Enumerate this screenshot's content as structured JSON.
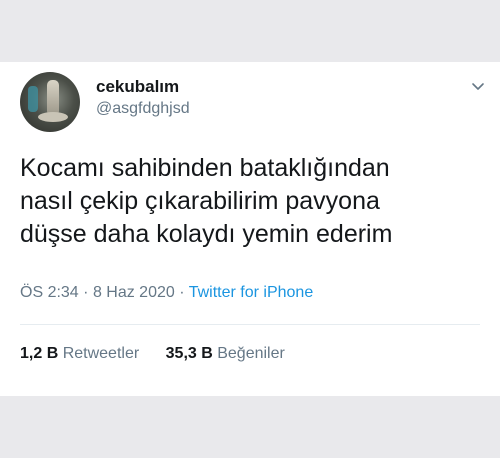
{
  "tweet": {
    "author": {
      "display_name": "cekubalım",
      "handle": "@asgfdghjsd"
    },
    "text_lines": [
      "Kocamı sahibinden bataklığından",
      "nasıl çekip çıkarabilirim pavyona",
      "düşse daha kolaydı yemin ederim"
    ],
    "time": "ÖS 2:34",
    "date": "8 Haz 2020",
    "separator": "·",
    "source": "Twitter for iPhone",
    "stats": {
      "retweets_count": "1,2 B",
      "retweets_label": "Retweetler",
      "likes_count": "35,3 B",
      "likes_label": "Beğeniler"
    }
  },
  "icons": {
    "more": "chevron-down-icon"
  },
  "colors": {
    "background": "#e9e9ec",
    "card": "#ffffff",
    "text": "#14171a",
    "secondary": "#657786",
    "link": "#1b95e0"
  }
}
